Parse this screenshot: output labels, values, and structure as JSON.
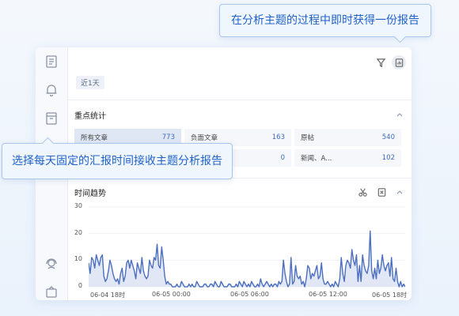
{
  "tooltips": {
    "top": "在分析主题的过程中即时获得一份报告",
    "middle": "选择每天固定的汇报时间接收主题分析报告"
  },
  "toolbar": {
    "icons": [
      "filter-icon",
      "report-icon"
    ]
  },
  "time_chip": "近1天",
  "stats_section": {
    "title": "重点统计",
    "items": [
      {
        "label": "所有文章",
        "value": "773",
        "selected": true
      },
      {
        "label": "负面文章",
        "value": "163"
      },
      {
        "label": "原帖",
        "value": "540"
      },
      {
        "label": "",
        "value": "0"
      },
      {
        "label": "新闻、A...",
        "value": "102"
      }
    ]
  },
  "trend_section": {
    "title": "时间趋势",
    "icons": [
      "scissors-icon",
      "excel-export-icon",
      "chevron-up-icon"
    ]
  },
  "colors": {
    "accent": "#3f6bbf",
    "line": "#4d6fc0",
    "area": "#e1e7f5",
    "tooltip_text": "#1f62c8"
  },
  "chart_data": {
    "type": "area",
    "title": "时间趋势",
    "ylim": [
      0,
      30
    ],
    "y_ticks": [
      "30",
      "20",
      "10",
      "0"
    ],
    "x_ticks": [
      "06-04 18时",
      "06-05 00:00",
      "06-05 06:00",
      "06-05 12:00",
      "06-05 18时"
    ],
    "values": [
      9,
      5,
      11,
      10,
      7,
      12,
      10,
      8,
      11,
      12,
      4,
      2,
      3,
      6,
      10,
      8,
      5,
      3,
      2,
      3,
      1,
      5,
      7,
      2,
      4,
      9,
      10,
      7,
      10,
      8,
      6,
      3,
      9,
      7,
      5,
      11,
      6,
      4,
      3,
      4,
      10,
      8,
      7,
      11,
      10,
      16,
      8,
      7,
      15,
      10,
      4,
      1,
      2,
      1,
      1,
      0,
      0,
      0,
      1,
      0,
      0,
      2,
      1,
      0,
      0,
      0,
      1,
      0,
      1,
      0,
      0,
      2,
      1,
      0,
      0,
      0,
      1,
      1,
      0,
      0,
      1,
      1,
      0,
      2,
      1,
      0,
      0,
      2,
      1,
      0,
      0,
      0,
      1,
      1,
      0,
      0,
      0,
      1,
      0,
      2,
      1,
      0,
      2,
      1,
      0,
      1,
      0,
      2,
      1,
      0,
      0,
      1,
      0,
      3,
      1,
      0,
      1,
      2,
      1,
      0,
      1,
      0,
      1,
      1,
      0,
      2,
      1,
      2,
      10,
      5,
      2,
      0,
      1,
      11,
      1,
      2,
      8,
      4,
      3,
      4,
      1,
      2,
      0,
      3,
      8,
      7,
      3,
      5,
      4,
      6,
      8,
      3,
      4,
      9,
      3,
      1,
      1,
      2,
      1,
      0,
      1,
      0,
      2,
      1,
      0,
      3,
      11,
      5,
      2,
      8,
      10,
      9,
      7,
      14,
      10,
      8,
      12,
      2,
      8,
      2,
      12,
      8,
      6,
      5,
      8,
      21,
      6,
      3,
      7,
      3,
      10,
      5,
      7,
      12,
      8,
      6,
      8,
      9,
      4,
      11,
      3,
      2,
      7,
      2,
      0,
      2,
      0,
      1,
      0
    ]
  }
}
